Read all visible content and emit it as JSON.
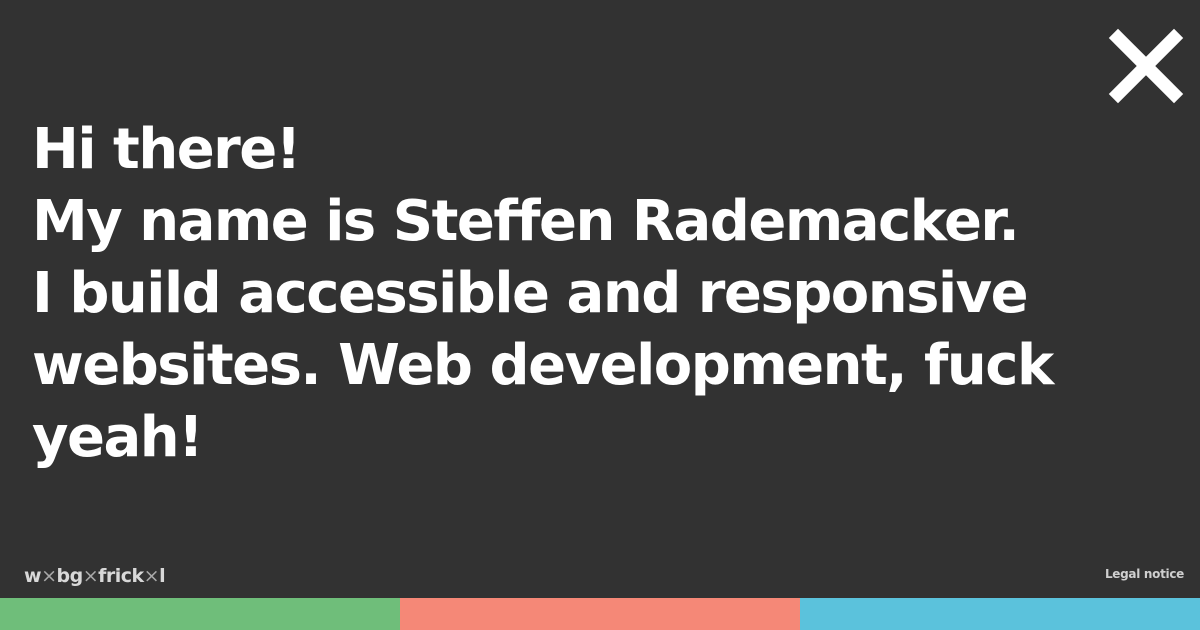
{
  "close": {
    "icon": "close-icon",
    "color": "#ffffff"
  },
  "intro": {
    "lines": [
      "Hi there!",
      "My name is Steffen Rademacker.",
      "I build accessible and responsive",
      "websites. Web development, fuck",
      "yeah!"
    ]
  },
  "logo": {
    "parts": [
      "w",
      "×",
      "bg",
      "×",
      "frick",
      "×",
      "l"
    ]
  },
  "footer": {
    "legal_notice": "Legal notice"
  },
  "colors": {
    "background": "#323232",
    "text": "#ffffff",
    "bar_green": "#6fbe7a",
    "bar_salmon": "#f58877",
    "bar_blue": "#5bc2dc"
  }
}
